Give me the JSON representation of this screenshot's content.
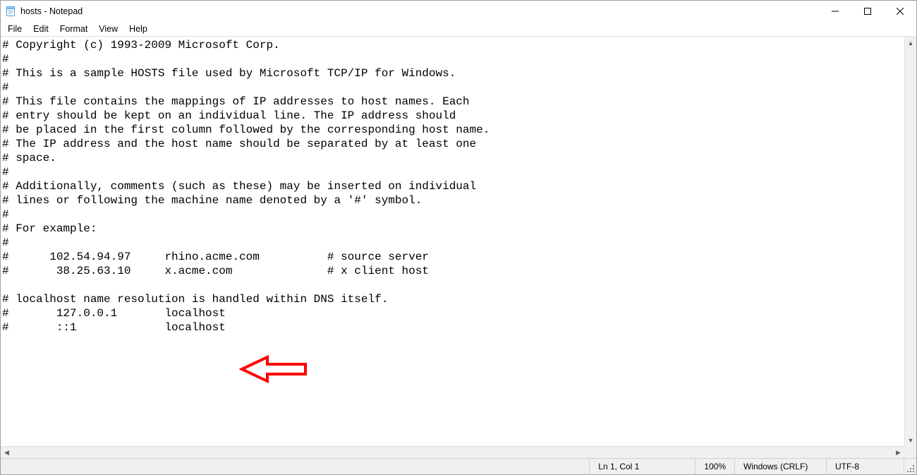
{
  "window": {
    "title": "hosts - Notepad"
  },
  "menu": {
    "items": [
      "File",
      "Edit",
      "Format",
      "View",
      "Help"
    ]
  },
  "editor": {
    "content": "# Copyright (c) 1993-2009 Microsoft Corp.\n#\n# This is a sample HOSTS file used by Microsoft TCP/IP for Windows.\n#\n# This file contains the mappings of IP addresses to host names. Each\n# entry should be kept on an individual line. The IP address should\n# be placed in the first column followed by the corresponding host name.\n# The IP address and the host name should be separated by at least one\n# space.\n#\n# Additionally, comments (such as these) may be inserted on individual\n# lines or following the machine name denoted by a '#' symbol.\n#\n# For example:\n#\n#      102.54.94.97     rhino.acme.com          # source server\n#       38.25.63.10     x.acme.com              # x client host\n\n# localhost name resolution is handled within DNS itself.\n#\t127.0.0.1       localhost\n#\t::1             localhost"
  },
  "annotation": {
    "arrow_color": "#ff0000"
  },
  "statusbar": {
    "position": "Ln 1, Col 1",
    "zoom": "100%",
    "line_endings": "Windows (CRLF)",
    "encoding": "UTF-8"
  }
}
